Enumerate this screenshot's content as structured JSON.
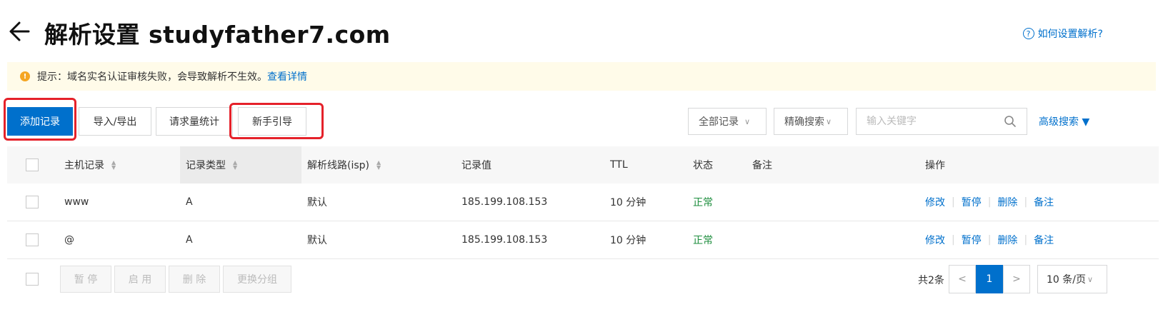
{
  "header": {
    "title": "解析设置 studyfather7.com",
    "help_icon": "?",
    "help_label": "如何设置解析?"
  },
  "notice": {
    "icon": "!",
    "text": "提示：域名实名认证审核失败，会导致解析不生效。",
    "link": "查看详情"
  },
  "toolbar": {
    "add_record": "添加记录",
    "import_export": "导入/导出",
    "request_stats": "请求量统计",
    "beginner_guide": "新手引导",
    "filter_all": "全部记录",
    "search_mode": "精确搜索",
    "search_placeholder": "输入关键字",
    "advanced_search": "高级搜索 ▼"
  },
  "table": {
    "columns": [
      "主机记录",
      "记录类型",
      "解析线路(isp)",
      "记录值",
      "TTL",
      "状态",
      "备注",
      "操作"
    ],
    "rows": [
      {
        "host": "www",
        "type": "A",
        "line": "默认",
        "value": "185.199.108.153",
        "ttl": "10 分钟",
        "status": "正常",
        "note": ""
      },
      {
        "host": "@",
        "type": "A",
        "line": "默认",
        "value": "185.199.108.153",
        "ttl": "10 分钟",
        "status": "正常",
        "note": ""
      }
    ],
    "actions": [
      "修改",
      "暂停",
      "删除",
      "备注"
    ]
  },
  "footer": {
    "pause": "暂 停",
    "enable": "启 用",
    "delete": "删 除",
    "change_group": "更换分组",
    "total": "共2条",
    "prev": "<",
    "current_page": "1",
    "next": ">",
    "page_size": "10 条/页"
  },
  "colors": {
    "primary": "#0070cc",
    "highlight": "#e5212a",
    "status_ok": "#1e8e3e",
    "warning": "#f5a623"
  }
}
